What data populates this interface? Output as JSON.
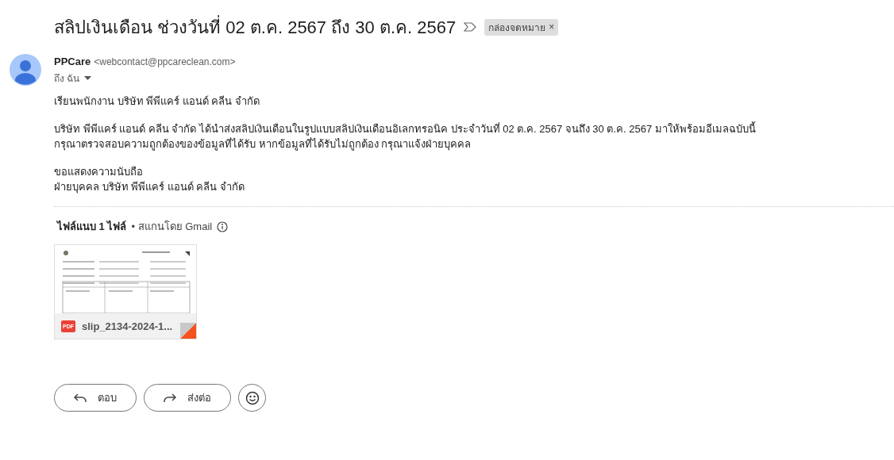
{
  "subject": "สลิปเงินเดือน ช่วงวันที่ 02 ต.ค. 2567 ถึง 30 ต.ค. 2567",
  "label": {
    "text": "กล่องจดหมาย",
    "remove": "×"
  },
  "sender": {
    "name": "PPCare",
    "email": "<webcontact@ppcareclean.com>",
    "recipient": "ถึง ฉัน"
  },
  "body": [
    {
      "lines": [
        "เรียนพนักงาน บริษัท พีพีแคร์ แอนด์ คลีน จำกัด"
      ]
    },
    {
      "lines": [
        "บริษัท พีพีแคร์ แอนด์ คลีน จำกัด ได้นำส่งสลิปเงินเดือนในรูปแบบสลิปเงินเดือนอิเลกทรอนิค ประจำวันที่ 02 ต.ค. 2567 จนถึง 30 ต.ค. 2567 มาให้พร้อมอีเมลฉบับนี้",
        "กรุณาตรวจสอบความถูกต้องของข้อมูลที่ได้รับ หากข้อมูลที่ได้รับไม่ถูกต้อง กรุณาแจ้งฝ่ายบุคคล"
      ]
    },
    {
      "lines": [
        "ขอแสดงความนับถือ",
        "ฝ่ายบุคคล บริษัท พีพีแคร์ แอนด์ คลีน จำกัด"
      ]
    }
  ],
  "attachments": {
    "title": "ไฟล์แนบ 1 ไฟล์",
    "scan_note": "• สแกนโดย Gmail",
    "files": [
      {
        "kind": "picture",
        "type_badge": "PDF",
        "name": "slip_2134-2024-1..."
      }
    ]
  },
  "actions": [
    {
      "kind": "reply",
      "label": "ตอบ"
    },
    {
      "kind": "forward",
      "label": "ส่งต่อ"
    },
    {
      "kind": "emoji"
    }
  ]
}
